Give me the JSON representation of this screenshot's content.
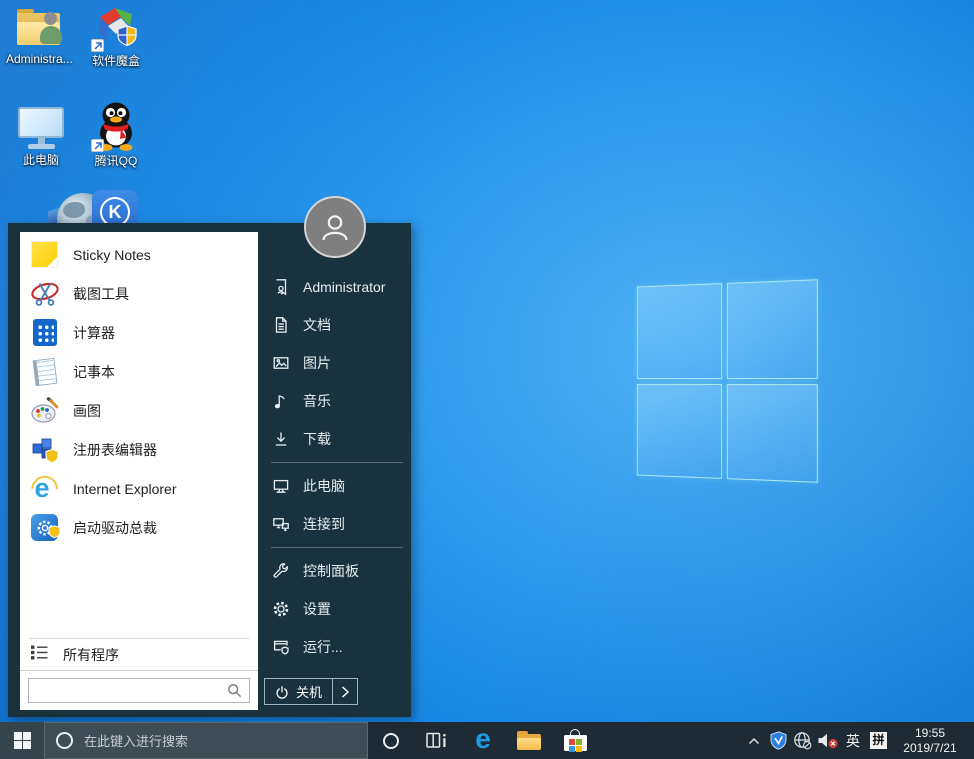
{
  "desktop": {
    "icons": [
      {
        "id": "administrator",
        "label": "Administra..."
      },
      {
        "id": "software-magic-box",
        "label": "软件魔盒"
      },
      {
        "id": "this-pc",
        "label": "此电脑"
      },
      {
        "id": "tencent-qq",
        "label": "腾讯QQ"
      }
    ],
    "k_tile_letter": "K"
  },
  "start_menu": {
    "programs": [
      {
        "label": "Sticky Notes",
        "icon": "sticky-notes-icon"
      },
      {
        "label": "截图工具",
        "icon": "snipping-tool-icon"
      },
      {
        "label": "计算器",
        "icon": "calculator-icon"
      },
      {
        "label": "记事本",
        "icon": "notepad-icon"
      },
      {
        "label": "画图",
        "icon": "paint-icon"
      },
      {
        "label": "注册表编辑器",
        "icon": "registry-editor-icon"
      },
      {
        "label": "Internet Explorer",
        "icon": "internet-explorer-icon"
      },
      {
        "label": "启动驱动总裁",
        "icon": "driver-director-icon"
      }
    ],
    "all_programs_label": "所有程序",
    "search_placeholder": "",
    "ie_glyph": "e",
    "right_items": [
      {
        "label": "Administrator",
        "icon": "user-icon"
      },
      {
        "label": "文档",
        "icon": "documents-icon"
      },
      {
        "label": "图片",
        "icon": "pictures-icon"
      },
      {
        "label": "音乐",
        "icon": "music-icon"
      },
      {
        "label": "下载",
        "icon": "downloads-icon"
      },
      {
        "label": "此电脑",
        "icon": "this-pc-icon"
      },
      {
        "label": "连接到",
        "icon": "connect-to-icon"
      },
      {
        "label": "控制面板",
        "icon": "control-panel-icon"
      },
      {
        "label": "设置",
        "icon": "settings-icon"
      },
      {
        "label": "运行...",
        "icon": "run-icon"
      }
    ],
    "shutdown_label": "关机"
  },
  "taskbar": {
    "search_placeholder": "在此键入进行搜索",
    "edge_glyph": "e",
    "tray": {
      "language_indicator": "英",
      "ime_indicator": "拼",
      "time": "19:55",
      "date": "2019/7/21"
    }
  },
  "colors": {
    "wallpaper_blue": "#1487e8",
    "start_menu_dark": "#1a323e",
    "taskbar_dark": "#1e2b34",
    "taskbar_search_bg": "#3e4c56",
    "accent_sticky_yellow": "#ffd002"
  }
}
